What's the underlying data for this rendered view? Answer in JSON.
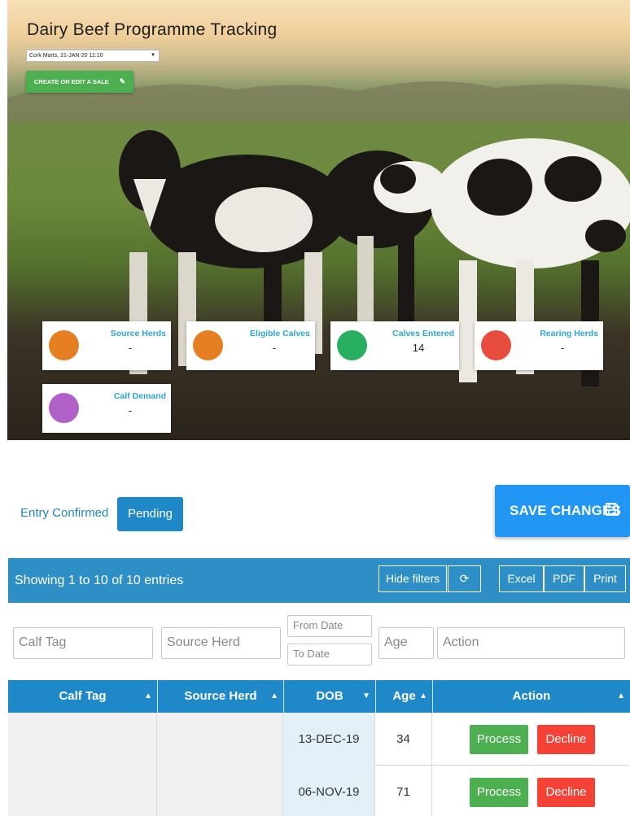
{
  "hero": {
    "title": "Dairy Beef Programme Tracking",
    "sale_select_value": "Cork Marts, 21-JAN-20 11:10",
    "create_sale_label": "CREATE OR EDIT A SALE",
    "stats": [
      {
        "label": "Source Herds",
        "value": "-",
        "color": "#e67e22"
      },
      {
        "label": "Eligible Calves",
        "value": "-",
        "color": "#e67e22"
      },
      {
        "label": "Calves Entered",
        "value": "14",
        "color": "#27ae60"
      },
      {
        "label": "Rearing Herds",
        "value": "-",
        "color": "#e74c3c"
      },
      {
        "label": "Calf Demand",
        "value": "-",
        "color": "#b061c8"
      }
    ]
  },
  "tabs": {
    "confirmed": "Entry Confirmed",
    "pending": "Pending"
  },
  "save_label": "SAVE CHANGES",
  "toolbar": {
    "showing": "Showing 1 to 10 of 10 entries",
    "hide_filters": "Hide filters",
    "refresh_icon": "refresh-icon",
    "excel": "Excel",
    "pdf": "PDF",
    "print": "Print"
  },
  "filters": {
    "calf_tag": "Calf Tag",
    "source_herd": "Source Herd",
    "from_date": "From Date",
    "to_date": "To Date",
    "age": "Age",
    "action": "Action"
  },
  "table": {
    "headers": [
      "Calf Tag",
      "Source Herd",
      "DOB",
      "Age",
      "Action"
    ],
    "rows": [
      {
        "calf_tag": "",
        "source_herd": "",
        "dob": "13-DEC-19",
        "age": "34"
      },
      {
        "calf_tag": "",
        "source_herd": "",
        "dob": "06-NOV-19",
        "age": "71"
      }
    ],
    "process_label": "Process",
    "decline_label": "Decline"
  },
  "colors": {
    "accent": "#1e88c9",
    "save": "#2196f3",
    "process": "#4caf50",
    "decline": "#f44336"
  }
}
